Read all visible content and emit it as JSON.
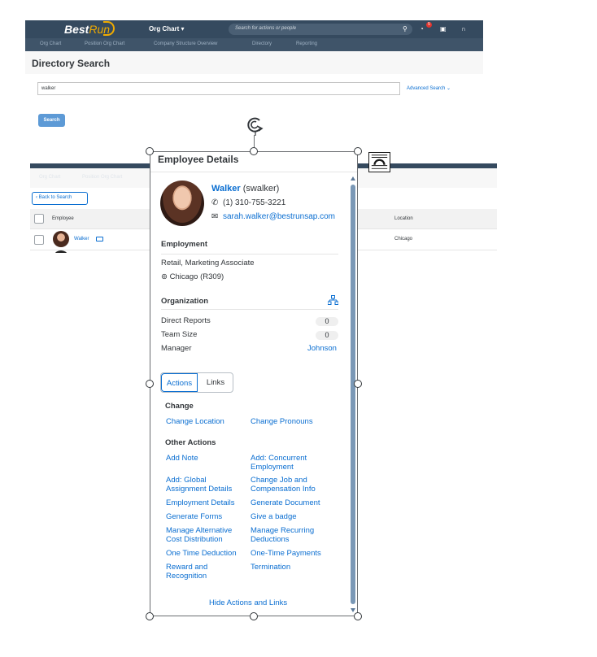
{
  "top_screen": {
    "brand": "Best",
    "brand_accent": "Run",
    "org_chart_menu": "Org Chart ▾",
    "search_placeholder": "Search for actions or people",
    "notification_count": "5",
    "subnav": [
      "Org Chart",
      "Position Org Chart",
      "Company Structure Overview",
      "Directory",
      "Reporting"
    ],
    "page_title": "Directory Search",
    "search_value": "walker",
    "advanced_search": "Advanced Search ⌄",
    "search_button": "Search"
  },
  "results_screen": {
    "nav": [
      "Org Chart",
      "Position Org Chart"
    ],
    "back_button": "‹ Back to Search",
    "col_employee": "Employee",
    "col_location": "Location",
    "row_name": "Walker",
    "row_location": "Chicago"
  },
  "popover": {
    "title": "Employee Details",
    "name": "Walker",
    "username": "(swalker)",
    "phone": "(1) 310-755-3221",
    "email": "sarah.walker@bestrunsap.com",
    "employment_title": "Employment",
    "job": "Retail, Marketing Associate",
    "location": "Chicago (R309)",
    "org_title": "Organization",
    "direct_reports_label": "Direct Reports",
    "direct_reports_value": "0",
    "team_size_label": "Team Size",
    "team_size_value": "0",
    "manager_label": "Manager",
    "manager_value": "Johnson",
    "tab_actions": "Actions",
    "tab_links": "Links",
    "change_title": "Change",
    "change_location": "Change Location",
    "change_pronouns": "Change Pronouns",
    "other_title": "Other Actions",
    "actions": {
      "add_note": "Add Note",
      "add_concurrent": "Add: Concurrent Employment",
      "add_global": "Add: Global Assignment Details",
      "change_job": "Change Job and Compensation Info",
      "employment_details": "Employment Details",
      "generate_document": "Generate Document",
      "generate_forms": "Generate Forms",
      "give_badge": "Give a badge",
      "manage_alt_cost": "Manage Alternative Cost Distribution",
      "manage_recurring": "Manage Recurring Deductions",
      "one_time_deduction": "One Time Deduction",
      "one_time_payments": "One-Time Payments",
      "reward": "Reward and Recognition",
      "termination": "Termination"
    },
    "hide_link": "Hide Actions and Links"
  },
  "colors": {
    "shell": "#354a5f",
    "link": "#0a6ed1",
    "text": "#32363a",
    "brand_accent": "#f0ab00",
    "notification": "#e3352e"
  }
}
